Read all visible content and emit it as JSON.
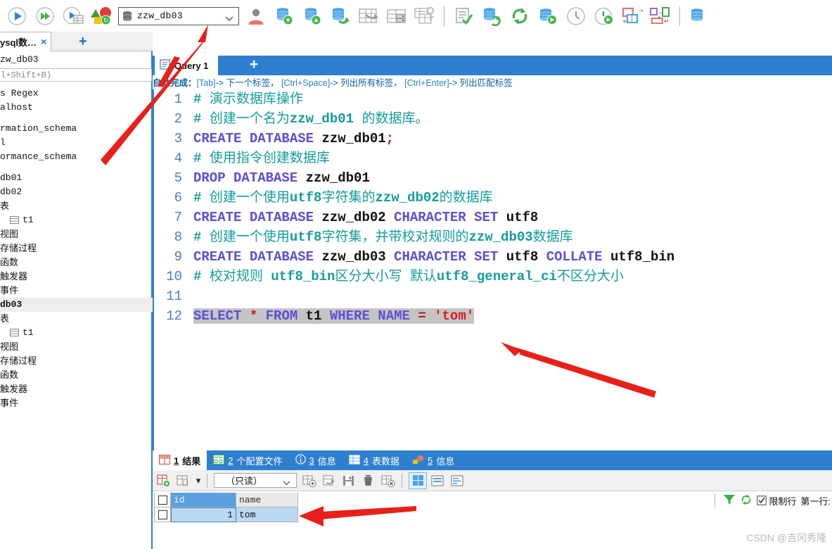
{
  "toolbar": {
    "icons": [
      {
        "name": "execute-icon",
        "label": "执行"
      },
      {
        "name": "execute-all-icon",
        "label": "执行全部"
      },
      {
        "name": "execute-to-table-icon",
        "label": "执行并显示表"
      },
      {
        "name": "refresh-tree-icon",
        "label": "刷新"
      }
    ],
    "db_selector": {
      "name": "db-selector",
      "value": "zzw_db03",
      "icon": "database-icon"
    },
    "right_icons": [
      {
        "name": "user-icon",
        "label": "用户"
      },
      {
        "name": "db-import-icon",
        "label": "导入数据库"
      },
      {
        "name": "db-export-icon",
        "label": "导出数据库"
      },
      {
        "name": "db-sync-icon",
        "label": "同步数据库"
      },
      {
        "name": "table-export-icon",
        "label": "导出表"
      },
      {
        "name": "table-data-icon",
        "label": "表数据"
      },
      {
        "name": "table-key-icon",
        "label": "表结构"
      },
      {
        "name": "document-check-icon",
        "label": "检查文档"
      },
      {
        "name": "db-refresh-icon",
        "label": "刷新数据库"
      },
      {
        "name": "refresh-icon",
        "label": "刷新"
      },
      {
        "name": "db-add-icon",
        "label": "新建数据库"
      },
      {
        "name": "clock-icon",
        "label": "历史"
      },
      {
        "name": "clock-run-icon",
        "label": "计划任务"
      },
      {
        "name": "window-layout-icon",
        "label": "窗口布局"
      },
      {
        "name": "transfer-icon",
        "label": "数据传输"
      },
      {
        "name": "db-last-icon",
        "label": "数据库"
      }
    ]
  },
  "sidebar": {
    "tab": {
      "label": "ysql数…",
      "close": "×",
      "add": "+"
    },
    "title": "zw_db03",
    "filter_placeholder": "l+Shift+B)",
    "tree": [
      {
        "label": "s Regex",
        "type": "text",
        "indent": 0
      },
      {
        "label": "alhost",
        "type": "host",
        "indent": 0
      },
      {
        "label": "rmation_schema",
        "type": "db",
        "indent": 0
      },
      {
        "label": "l",
        "type": "folder",
        "indent": 0
      },
      {
        "label": "ormance_schema",
        "type": "db",
        "indent": 0
      },
      {
        "label": "db01",
        "type": "db",
        "indent": 0
      },
      {
        "label": "db02",
        "type": "db",
        "indent": 0
      },
      {
        "label": "表",
        "type": "folder",
        "cjk": true,
        "indent": 0
      },
      {
        "label": "t1",
        "type": "table",
        "indent": 1
      },
      {
        "label": "视图",
        "type": "folder",
        "cjk": true,
        "indent": 0
      },
      {
        "label": "存储过程",
        "type": "folder",
        "cjk": true,
        "indent": 0
      },
      {
        "label": "函数",
        "type": "folder",
        "cjk": true,
        "indent": 0
      },
      {
        "label": "触发器",
        "type": "folder",
        "cjk": true,
        "indent": 0
      },
      {
        "label": "事件",
        "type": "folder",
        "cjk": true,
        "indent": 0
      },
      {
        "label": "db03",
        "type": "db",
        "selected": true,
        "indent": 0
      },
      {
        "label": "表",
        "type": "folder",
        "cjk": true,
        "indent": 0
      },
      {
        "label": "t1",
        "type": "table",
        "indent": 1
      },
      {
        "label": "视图",
        "type": "folder",
        "cjk": true,
        "indent": 0
      },
      {
        "label": "存储过程",
        "type": "folder",
        "cjk": true,
        "indent": 0
      },
      {
        "label": "函数",
        "type": "folder",
        "cjk": true,
        "indent": 0
      },
      {
        "label": "触发器",
        "type": "folder",
        "cjk": true,
        "indent": 0
      },
      {
        "label": "事件",
        "type": "folder",
        "cjk": true,
        "indent": 0
      }
    ]
  },
  "editor": {
    "tab": {
      "label": "Query 1",
      "icon": "query-icon"
    },
    "add_tab": "+",
    "hint": {
      "label": "自动完成：",
      "items": [
        {
          "key": "[Tab]",
          "arrow": "-> ",
          "text": "下一个标签，"
        },
        {
          "key": "[Ctrl+Space]",
          "arrow": "-> ",
          "text": "列出所有标签，"
        },
        {
          "key": "[Ctrl+Enter]",
          "arrow": "-> ",
          "text": "列出匹配标签"
        }
      ]
    },
    "lines": [
      {
        "n": "1",
        "html": "<span class='cm-m'>#</span> <span class='cm'>演示数据库操作</span>"
      },
      {
        "n": "2",
        "html": "<span class='cm-m'>#</span> <span class='cm'>创建一个名为</span><span class='cm-m'>zzw_db01</span> <span class='cm'>的数据库。</span>"
      },
      {
        "n": "3",
        "html": "<span class='kw'>CREATE DATABASE</span> <span class='id'>zzw_db01</span><span class='pn'>;</span>"
      },
      {
        "n": "4",
        "html": "<span class='cm-m'>#</span> <span class='cm'>使用指令创建数据库</span>"
      },
      {
        "n": "5",
        "html": "<span class='kw'>DROP DATABASE</span> <span class='id'>zzw_db01</span>"
      },
      {
        "n": "6",
        "html": "<span class='cm-m'>#</span> <span class='cm'>创建一个使用</span><span class='cm-m'>utf8</span><span class='cm'>字符集的</span><span class='cm-m'>zzw_db02</span><span class='cm'>的数据库</span>"
      },
      {
        "n": "7",
        "html": "<span class='kw'>CREATE DATABASE</span> <span class='id'>zzw_db02</span> <span class='kw'>CHARACTER SET</span> <span class='id'>utf8</span>"
      },
      {
        "n": "8",
        "html": "<span class='cm-m'>#</span> <span class='cm'>创建一个使用</span><span class='cm-m'>utf8</span><span class='cm'>字符集，并带校对规则的</span><span class='cm-m'>zzw_db03</span><span class='cm'>数据库</span>"
      },
      {
        "n": "9",
        "html": "<span class='kw'>CREATE DATABASE</span> <span class='id'>zzw_db03</span> <span class='kw'>CHARACTER SET</span> <span class='id'>utf8</span> <span class='kw'>COLLATE</span> <span class='id'>utf8_bin</span>"
      },
      {
        "n": "10",
        "html": "<span class='cm-m'>#</span> <span class='cm'>校对规则</span> <span class='cm-m'>utf8_bin</span><span class='cm'>区分大小写</span> <span class='cm'>默认</span><span class='cm-m'>utf8_general_ci</span><span class='cm'>不区分大小</span>"
      },
      {
        "n": "11",
        "html": ""
      },
      {
        "n": "12",
        "html": "<span class='hl'><span class='kw'>SELECT</span> <span class='star'>*</span> <span class='kw'>FROM</span> <span class='id'>t1</span> <span class='kw'>WHERE NAME</span> <span class='pn'>=</span> <span class='str'>'tom'</span></span>"
      }
    ],
    "plain_lines": [
      "# 演示数据库操作",
      "# 创建一个名为zzw_db01 的数据库。",
      "CREATE DATABASE zzw_db01;",
      "# 使用指令创建数据库",
      "DROP DATABASE zzw_db01",
      "# 创建一个使用utf8字符集的zzw_db02的数据库",
      "CREATE DATABASE zzw_db02 CHARACTER SET utf8",
      "# 创建一个使用utf8字符集，并带校对规则的zzw_db03数据库",
      "CREATE DATABASE zzw_db03 CHARACTER SET utf8 COLLATE utf8_bin",
      "# 校对规则 utf8_bin区分大小写 默认utf8_general_ci不区分大小",
      "",
      "SELECT * FROM t1 WHERE NAME = 'tom'"
    ]
  },
  "results": {
    "tabs": [
      {
        "num": "1",
        "label": "结果",
        "icon": "grid-icon",
        "active": true
      },
      {
        "num": "2",
        "label": "个配置文件",
        "icon": "profile-icon",
        "active": false
      },
      {
        "num": "3",
        "label": "信息",
        "icon": "info-icon",
        "active": false
      },
      {
        "num": "4",
        "label": "表数据",
        "icon": "table-icon",
        "active": false
      },
      {
        "num": "5",
        "label": "信息",
        "icon": "chart-icon",
        "active": false
      }
    ],
    "toolbar": {
      "add_record_icon": "add-record-icon",
      "delete_record_icon": "delete-record-icon",
      "dropdown_caret": "▾",
      "mode_select": "（只读）",
      "icons": [
        {
          "name": "new-row-icon"
        },
        {
          "name": "duplicate-row-icon"
        },
        {
          "name": "save-icon"
        },
        {
          "name": "delete-icon"
        },
        {
          "name": "cancel-edit-icon"
        }
      ],
      "views": [
        {
          "name": "grid-view-button",
          "active": true
        },
        {
          "name": "form-view-button",
          "active": false
        },
        {
          "name": "text-view-button",
          "active": false
        }
      ],
      "filter_icon": "filter-icon",
      "refresh_icon": "refresh-icon",
      "limit_checkbox_label": "限制行",
      "limit_checked": true,
      "first_row_label": "第一行:"
    },
    "grid": {
      "columns": [
        "id",
        "name"
      ],
      "rows": [
        [
          "1",
          "tom"
        ]
      ]
    }
  },
  "watermark": "CSDN @吉冈秀隆",
  "colors": {
    "accent": "#2f7fd0",
    "comment": "#169c9c",
    "keyword": "#5b4fd6",
    "string": "#e01b1b",
    "linenum": "#4a7fb5",
    "annotation_red": "#e8201a"
  }
}
